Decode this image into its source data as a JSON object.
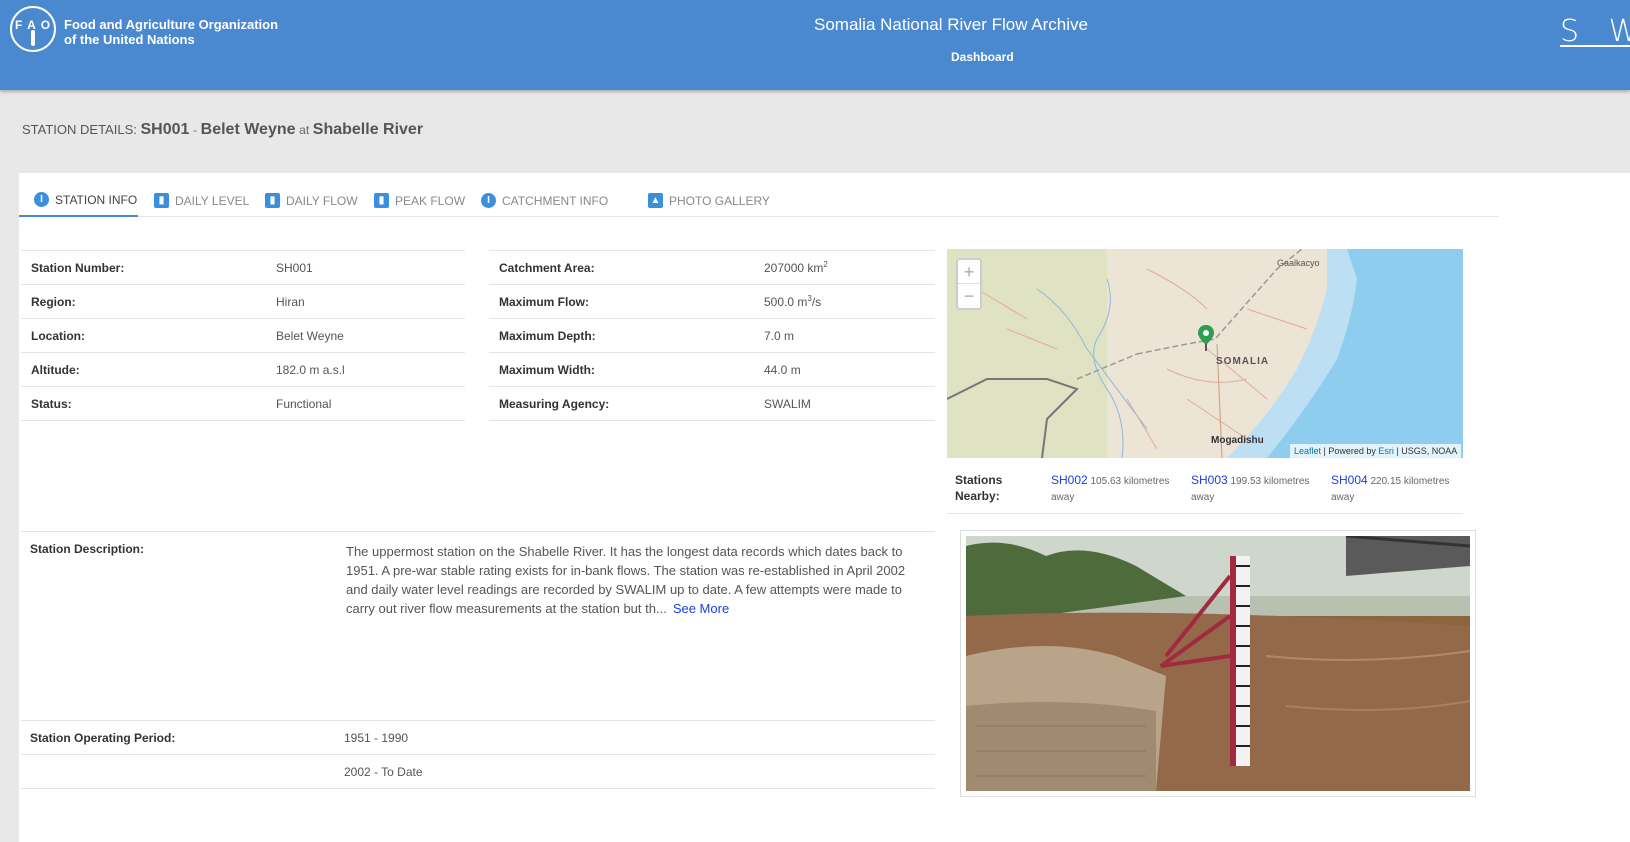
{
  "header": {
    "org_line1": "Food and Agriculture Organization",
    "org_line2": "of the United Nations",
    "logo_letters": "F A O",
    "app_title": "Somalia National River Flow Archive",
    "nav_dashboard": "Dashboard",
    "brand_partial": "S W A"
  },
  "station_heading": {
    "prefix": "STATION DETAILS:",
    "code": "SH001",
    "dash": "-",
    "name": "Belet Weyne",
    "at": "at",
    "river": "Shabelle River"
  },
  "tabs": [
    {
      "label": "STATION INFO",
      "icon": "info-icon",
      "active": true
    },
    {
      "label": "DAILY LEVEL",
      "icon": "bar-chart-icon"
    },
    {
      "label": "DAILY FLOW",
      "icon": "bar-chart-icon"
    },
    {
      "label": "PEAK FLOW",
      "icon": "bar-chart-icon"
    },
    {
      "label": "CATCHMENT INFO",
      "icon": "info-icon"
    },
    {
      "label": "PHOTO GALLERY",
      "icon": "image-icon"
    }
  ],
  "left_table": [
    {
      "label": "Station Number:",
      "value": "SH001"
    },
    {
      "label": "Region:",
      "value": "Hiran"
    },
    {
      "label": "Location:",
      "value": "Belet Weyne"
    },
    {
      "label": "Altitude:",
      "value": "182.0 m a.s.l"
    },
    {
      "label": "Status:",
      "value": "Functional"
    }
  ],
  "right_table": [
    {
      "label": "Catchment Area:",
      "value": "207000 km",
      "sup": "2",
      "suffix": ""
    },
    {
      "label": "Maximum Flow:",
      "value": "500.0 m",
      "sup": "3",
      "suffix": "/s"
    },
    {
      "label": "Maximum Depth:",
      "value": "7.0 m",
      "sup": "",
      "suffix": ""
    },
    {
      "label": "Maximum Width:",
      "value": "44.0 m",
      "sup": "",
      "suffix": ""
    },
    {
      "label": "Measuring Agency:",
      "value": "SWALIM",
      "sup": "",
      "suffix": ""
    }
  ],
  "map": {
    "zoom_in": "+",
    "zoom_out": "−",
    "labels": {
      "galkacyo": "Gaalkacyo",
      "country": "SOMALIA",
      "capital": "Mogadishu"
    },
    "attribution": {
      "leaflet": "Leaflet",
      "powered": " | Powered by ",
      "esri": "Esri",
      "rest": " | USGS, NOAA"
    },
    "colors": {
      "land": "#ece4d4",
      "sea": "#a8d4f0",
      "marker": "#2e9e4f"
    }
  },
  "nearby": {
    "label": "Stations Nearby:",
    "stations": [
      {
        "code": "SH002",
        "distance": "105.63 kilometres away"
      },
      {
        "code": "SH003",
        "distance": "199.53 kilometres away"
      },
      {
        "code": "SH004",
        "distance": "220.15 kilometres away"
      }
    ]
  },
  "description": {
    "label": "Station Description:",
    "text": "The uppermost station on the Shabelle River. It has the longest data records which dates back to 1951. A pre-war stable rating exists for in-bank flows. The station was re-established in April 2002 and daily water level readings are recorded by SWALIM up to date. A few attempts were made to carry out river flow measurements at the station but th...",
    "see_more": "See More"
  },
  "operating_period": {
    "label": "Station Operating Period:",
    "periods": [
      "1951 - 1990",
      "2002 - To Date"
    ]
  }
}
